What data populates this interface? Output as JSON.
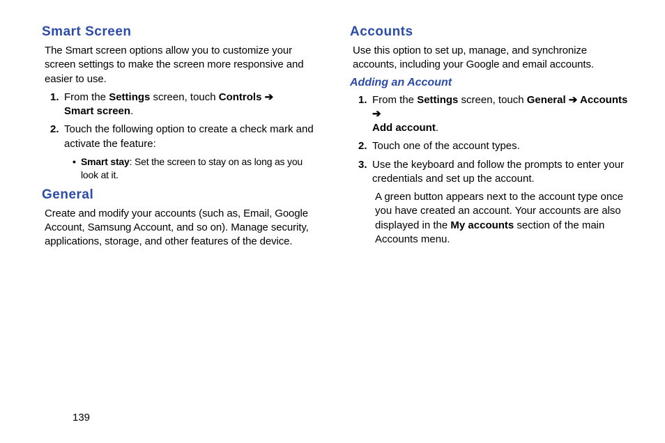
{
  "left": {
    "section1": {
      "title": "Smart Screen",
      "intro": "The Smart screen options allow you to customize your screen settings to make the screen more responsive and easier to use.",
      "step1_prefix": "From the ",
      "step1_b1": "Settings",
      "step1_mid": " screen, touch ",
      "step1_b2": "Controls ",
      "step1_arrow": "➔",
      "step1_b3": "Smart screen",
      "step1_suffix": ".",
      "step2": "Touch the following option to create a check mark and activate the feature:",
      "bullet_b": "Smart stay",
      "bullet_txt": ": Set the screen to stay on as long as you look at it."
    },
    "section2": {
      "title": "General",
      "intro": "Create and modify your accounts (such as, Email, Google Account, Samsung Account, and so on). Manage security, applications, storage, and other features of the device."
    }
  },
  "right": {
    "section1": {
      "title": "Accounts",
      "intro": "Use this option to set up, manage, and synchronize accounts, including your Google and email accounts."
    },
    "section2": {
      "title": "Adding an Account",
      "step1_prefix": "From the ",
      "step1_b1": "Settings",
      "step1_mid": " screen, touch ",
      "step1_b2": "General ",
      "step1_arrow1": "➔",
      "step1_b3": " Accounts ",
      "step1_arrow2": "➔",
      "step1_b4": "Add account",
      "step1_suffix": ".",
      "step2": "Touch one of the account types.",
      "step3": "Use the keyboard and follow the prompts to enter your credentials and set up the account.",
      "cont_prefix": "A green button appears next to the account type once you have created an account. Your accounts are also displayed in the ",
      "cont_b": "My accounts",
      "cont_suffix": " section of the main Accounts menu."
    }
  },
  "page_number": "139"
}
